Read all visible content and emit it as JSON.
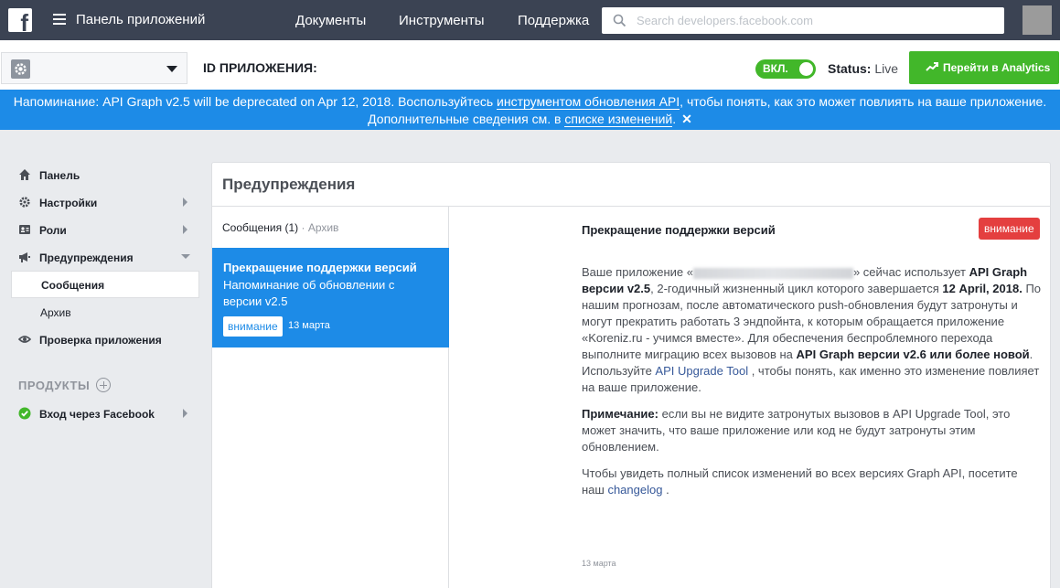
{
  "topbar": {
    "app_panel_title": "Панель приложений",
    "nav": [
      "Документы",
      "Инструменты",
      "Поддержка"
    ],
    "search_placeholder": "Search developers.facebook.com"
  },
  "appbar": {
    "app_id_label": "ID ПРИЛОЖЕНИЯ:",
    "toggle_label": "ВКЛ.",
    "status_label": "Status:",
    "status_value": "Live",
    "analytics_button": "Перейти в Analytics"
  },
  "banner": {
    "text1": "Напоминание: API Graph v2.5 will be deprecated on Apr 12, 2018. Воспользуйтесь ",
    "link1": "инструментом обновления API",
    "text2": ", чтобы понять, как это может повлиять на ваше приложение.",
    "text3": "Дополнительные сведения см. в ",
    "link2": "списке изменений",
    "text4": ".",
    "close": "✕"
  },
  "sidebar": {
    "items": [
      {
        "label": "Панель"
      },
      {
        "label": "Настройки"
      },
      {
        "label": "Роли"
      },
      {
        "label": "Предупреждения"
      }
    ],
    "sub_items": [
      {
        "label": "Сообщения"
      },
      {
        "label": "Архив"
      }
    ],
    "review": "Проверка приложения",
    "products_header": "ПРОДУКТЫ",
    "fb_login": "Вход через Facebook"
  },
  "main": {
    "title": "Предупреждения",
    "tab_messages": "Сообщения (1)",
    "tab_separator": " · ",
    "tab_archive": "Архив",
    "message": {
      "title": "Прекращение поддержки версий",
      "subtitle": "Напоминание об обновлении с версии v2.5",
      "badge": "внимание",
      "date": "13 марта"
    },
    "detail": {
      "title": "Прекращение поддержки версий",
      "badge": "внимание",
      "p1_a": "Ваше приложение «",
      "p1_b": "» сейчас использует ",
      "p1_c": "API Graph версии v2.5",
      "p1_d": ", 2-годичный жизненный цикл которого завершается ",
      "p1_e": "12 April, 2018.",
      "p1_f": " По нашим прогнозам, после автоматического push-обновления будут затронуты и могут прекратить работать 3 эндпойнта, к которым обращается приложение «Koreniz.ru - учимся вместе». Для обеспечения беспроблемного перехода выполните миграцию всех вызовов на ",
      "p1_g": "API Graph версии v2.6 или более новой",
      "p1_h": ". Используйте ",
      "p1_link": "API Upgrade Tool",
      "p1_i": " , чтобы понять, как именно это изменение повлияет на ваше приложение.",
      "p2_label": "Примечание:",
      "p2_text": " если вы не видите затронутых вызовов в API Upgrade Tool, это может значить, что ваше приложение или код не будут затронуты этим обновлением.",
      "p3_text": "Чтобы увидеть полный список изменений во всех версиях Graph API, посетите наш ",
      "p3_link": "changelog",
      "p3_end": " .",
      "date": "13 марта"
    }
  },
  "colors": {
    "topbar": "#3b4353",
    "accent_blue": "#1d8be7",
    "green": "#42b72a",
    "red": "#e43f3f"
  }
}
